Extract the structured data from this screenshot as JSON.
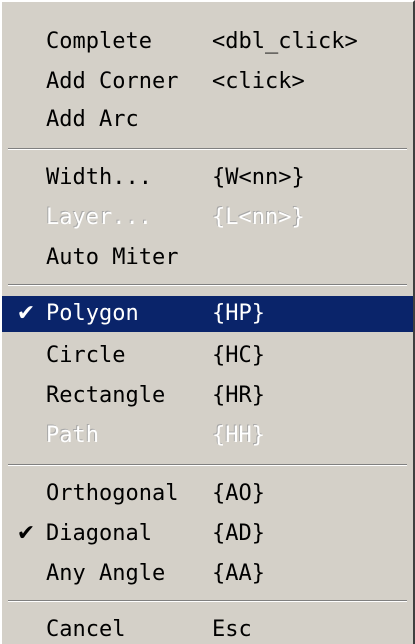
{
  "menu": {
    "groups": [
      {
        "items": [
          {
            "label": "Complete",
            "accel": "<dbl_click>"
          },
          {
            "label": "Add Corner",
            "accel": "<click>"
          },
          {
            "label": "Add Arc",
            "accel": ""
          }
        ]
      },
      {
        "items": [
          {
            "label": "Width...",
            "accel": "{W<nn>}"
          },
          {
            "label": "Layer...",
            "accel": "{L<nn>}",
            "disabled": true
          },
          {
            "label": "Auto Miter",
            "accel": ""
          }
        ]
      },
      {
        "items": [
          {
            "label": "Polygon",
            "accel": "{HP}",
            "checked": true,
            "selected": true
          },
          {
            "label": "Circle",
            "accel": "{HC}"
          },
          {
            "label": "Rectangle",
            "accel": "{HR}"
          },
          {
            "label": "Path",
            "accel": "{HH}",
            "disabled": true
          }
        ]
      },
      {
        "items": [
          {
            "label": "Orthogonal",
            "accel": "{AO}"
          },
          {
            "label": "Diagonal",
            "accel": "{AD}",
            "checked": true
          },
          {
            "label": "Any Angle",
            "accel": "{AA}"
          }
        ]
      },
      {
        "items": [
          {
            "label": "Cancel",
            "accel": "Esc"
          }
        ]
      }
    ],
    "check_glyph": "✔",
    "colors": {
      "background": "#d4d0c8",
      "highlight": "#0a246a",
      "highlight_text": "#ffffff",
      "disabled_text": "#a8a8a8"
    }
  }
}
